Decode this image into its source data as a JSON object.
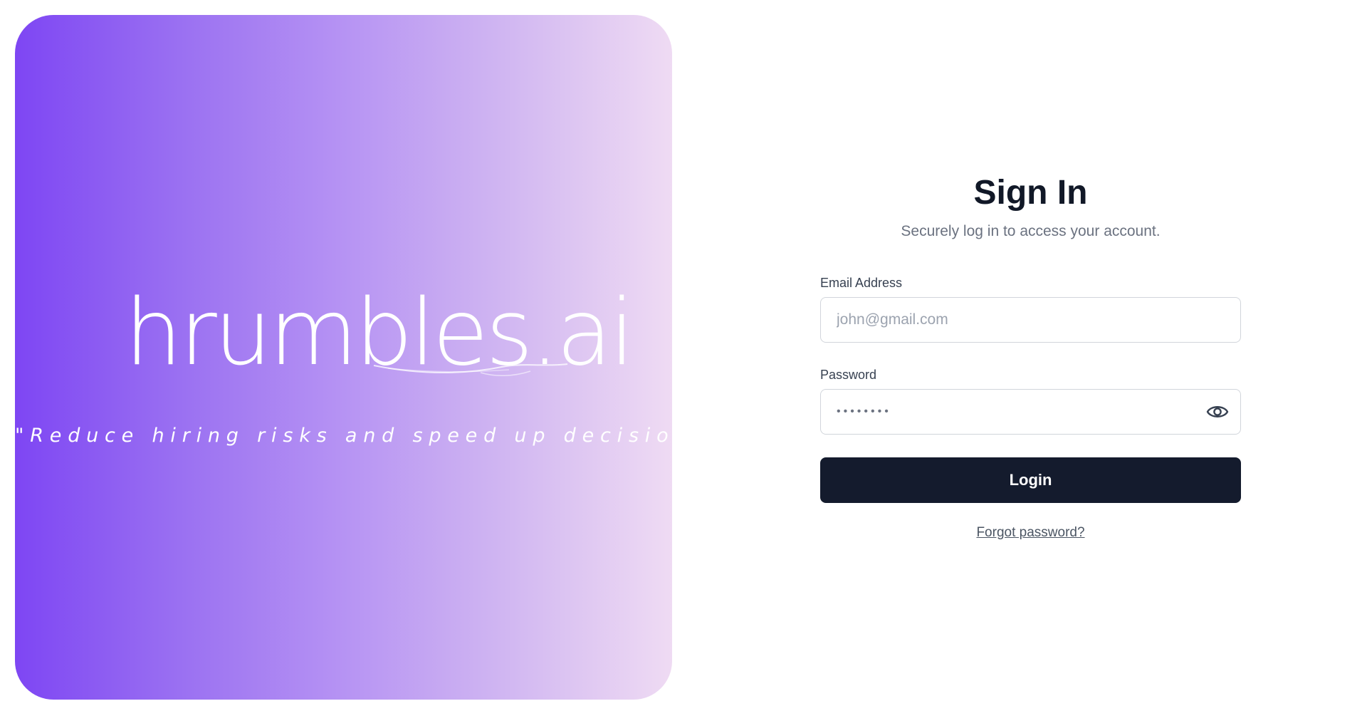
{
  "brand": {
    "logo_text": "hrumbles.ai",
    "tagline": "\"Reduce hiring risks and speed up decisions\"",
    "gradient_start": "#7e46f3",
    "gradient_end": "#efdbf3"
  },
  "form": {
    "title": "Sign In",
    "subtitle": "Securely log in to access your account.",
    "email": {
      "label": "Email Address",
      "placeholder": "john@gmail.com",
      "value": ""
    },
    "password": {
      "label": "Password",
      "masked_value": "••••••••",
      "toggle_icon": "eye-icon"
    },
    "login_label": "Login",
    "forgot_label": "Forgot password?",
    "button_color": "#141b2d"
  }
}
